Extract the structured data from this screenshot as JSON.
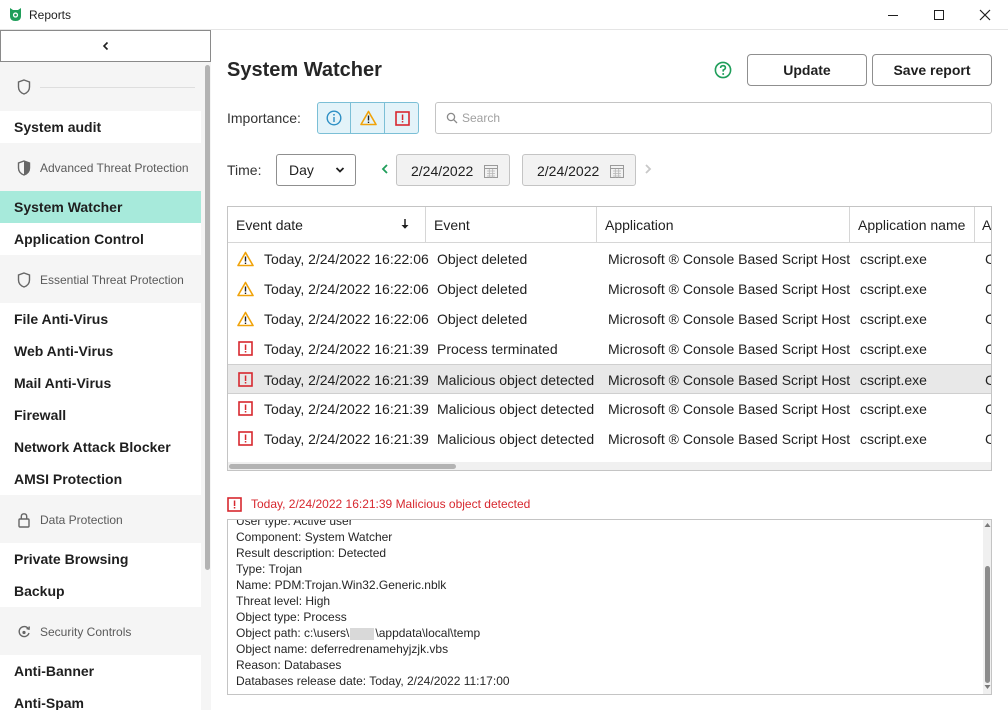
{
  "window": {
    "title": "Reports"
  },
  "sidebar": {
    "sections": [
      {
        "label": "",
        "icon": "shield-icon"
      },
      {
        "label": "Advanced Threat Protection",
        "icon": "shield-half-icon"
      },
      {
        "label": "Essential Threat Protection",
        "icon": "shield-icon"
      },
      {
        "label": "Data Protection",
        "icon": "lock-icon"
      },
      {
        "label": "Security Controls",
        "icon": "refresh-shield-icon"
      }
    ],
    "items": [
      {
        "label": "System audit",
        "active": false
      },
      {
        "label": "System Watcher",
        "active": true
      },
      {
        "label": "Application Control",
        "active": false
      },
      {
        "label": "File Anti-Virus",
        "active": false
      },
      {
        "label": "Web Anti-Virus",
        "active": false
      },
      {
        "label": "Mail Anti-Virus",
        "active": false
      },
      {
        "label": "Firewall",
        "active": false
      },
      {
        "label": "Network Attack Blocker",
        "active": false
      },
      {
        "label": "AMSI Protection",
        "active": false
      },
      {
        "label": "Private Browsing",
        "active": false
      },
      {
        "label": "Backup",
        "active": false
      },
      {
        "label": "Anti-Banner",
        "active": false
      },
      {
        "label": "Anti-Spam",
        "active": false
      }
    ]
  },
  "main": {
    "title": "System Watcher",
    "update_label": "Update",
    "save_report_label": "Save report",
    "importance_label": "Importance:",
    "search_placeholder": "Search",
    "time_label": "Time:",
    "time_value": "Day",
    "date_from": "2/24/2022",
    "date_to": "2/24/2022"
  },
  "table": {
    "columns": [
      "Event date",
      "Event",
      "Application",
      "Application name",
      "A"
    ],
    "rows": [
      {
        "level": "warning",
        "date": "Today, 2/24/2022 16:22:06",
        "event": "Object deleted",
        "application": "Microsoft ® Console Based Script Host",
        "app_name": "cscript.exe",
        "extra": "C"
      },
      {
        "level": "warning",
        "date": "Today, 2/24/2022 16:22:06",
        "event": "Object deleted",
        "application": "Microsoft ® Console Based Script Host",
        "app_name": "cscript.exe",
        "extra": "C"
      },
      {
        "level": "warning",
        "date": "Today, 2/24/2022 16:22:06",
        "event": "Object deleted",
        "application": "Microsoft ® Console Based Script Host",
        "app_name": "cscript.exe",
        "extra": "C"
      },
      {
        "level": "critical",
        "date": "Today, 2/24/2022 16:21:39",
        "event": "Process terminated",
        "application": "Microsoft ® Console Based Script Host",
        "app_name": "cscript.exe",
        "extra": "C"
      },
      {
        "level": "critical",
        "date": "Today, 2/24/2022 16:21:39",
        "event": "Malicious object detected",
        "application": "Microsoft ® Console Based Script Host",
        "app_name": "cscript.exe",
        "extra": "C",
        "selected": true
      },
      {
        "level": "critical",
        "date": "Today, 2/24/2022 16:21:39",
        "event": "Malicious object detected",
        "application": "Microsoft ® Console Based Script Host",
        "app_name": "cscript.exe",
        "extra": "C"
      },
      {
        "level": "critical",
        "date": "Today, 2/24/2022 16:21:39",
        "event": "Malicious object detected",
        "application": "Microsoft ® Console Based Script Host",
        "app_name": "cscript.exe",
        "extra": "C"
      }
    ]
  },
  "details": {
    "heading": "Today, 2/24/2022 16:21:39 Malicious object detected",
    "lines": [
      "User type: Active user",
      "Component: System Watcher",
      "Result description: Detected",
      "Type: Trojan",
      "Name: PDM:Trojan.Win32.Generic.nblk",
      "Threat level: High",
      "Object type: Process",
      "Object path: c:\\users\\",
      "Object name: deferredrenamehyjzjk.vbs",
      "Reason: Databases",
      "Databases release date: Today, 2/24/2022 11:17:00"
    ],
    "object_path_suffix": "\\appdata\\local\\temp"
  },
  "colors": {
    "accent": "#a7eadb",
    "brand_green": "#1f9e5a",
    "warning": "#f0a30a",
    "critical": "#d7282f",
    "info": "#2d8fc4"
  }
}
